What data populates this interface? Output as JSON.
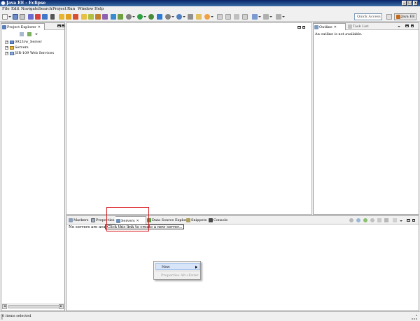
{
  "window": {
    "title": "Java EE - Eclipse"
  },
  "menu": [
    "File",
    "Edit",
    "Navigate",
    "Search",
    "Project",
    "Run",
    "Window",
    "Help"
  ],
  "toolbar": {
    "quick_access_placeholder": "Quick Access",
    "perspective_label": "Java EE",
    "icons": [
      "new-icon",
      "save-icon",
      "print-icon",
      "server-start-icon",
      "server-stop-icon",
      "publish-icon",
      "new-server-icon",
      "debug-icon",
      "run-icon",
      "external-tools-icon",
      "new-java-project-icon",
      "new-package-icon",
      "new-class-icon",
      "open-type-icon",
      "search-icon",
      "annotation-next-icon",
      "back-icon",
      "forward-icon"
    ]
  },
  "project_explorer": {
    "tab_label": "Project Explorer",
    "items": [
      {
        "label": "0923rw_Server",
        "icon": "project-folder-icon"
      },
      {
        "label": "Servers",
        "icon": "servers-folder-icon"
      },
      {
        "label": "JSR-109 Web Services",
        "icon": "web-services-icon"
      }
    ]
  },
  "outline": {
    "tab_label": "Outline",
    "tasklist_label": "Task List",
    "message": "An outline is not available."
  },
  "bottom_tabs": [
    {
      "label": "Markers",
      "icon": "markers-icon",
      "active": false
    },
    {
      "label": "Properties",
      "icon": "properties-icon",
      "active": false
    },
    {
      "label": "Servers",
      "icon": "servers-icon",
      "active": true
    },
    {
      "label": "Data Source Explorer",
      "icon": "data-source-icon",
      "active": false
    },
    {
      "label": "Snippets",
      "icon": "snippets-icon",
      "active": false
    },
    {
      "label": "Console",
      "icon": "console-icon",
      "active": false
    }
  ],
  "servers_view": {
    "no_servers_text": "No servers are available.",
    "create_link": "Click this link to create a new server..."
  },
  "context_menu": {
    "items": [
      {
        "label": "New",
        "has_submenu": true,
        "enabled": true
      },
      {
        "label": "Properties  Alt+Enter",
        "has_submenu": false,
        "enabled": false
      }
    ]
  },
  "status": {
    "text": "0 items selected"
  },
  "colors": {
    "highlight_box": "#d8161c",
    "title_bar": "#0a246a"
  }
}
